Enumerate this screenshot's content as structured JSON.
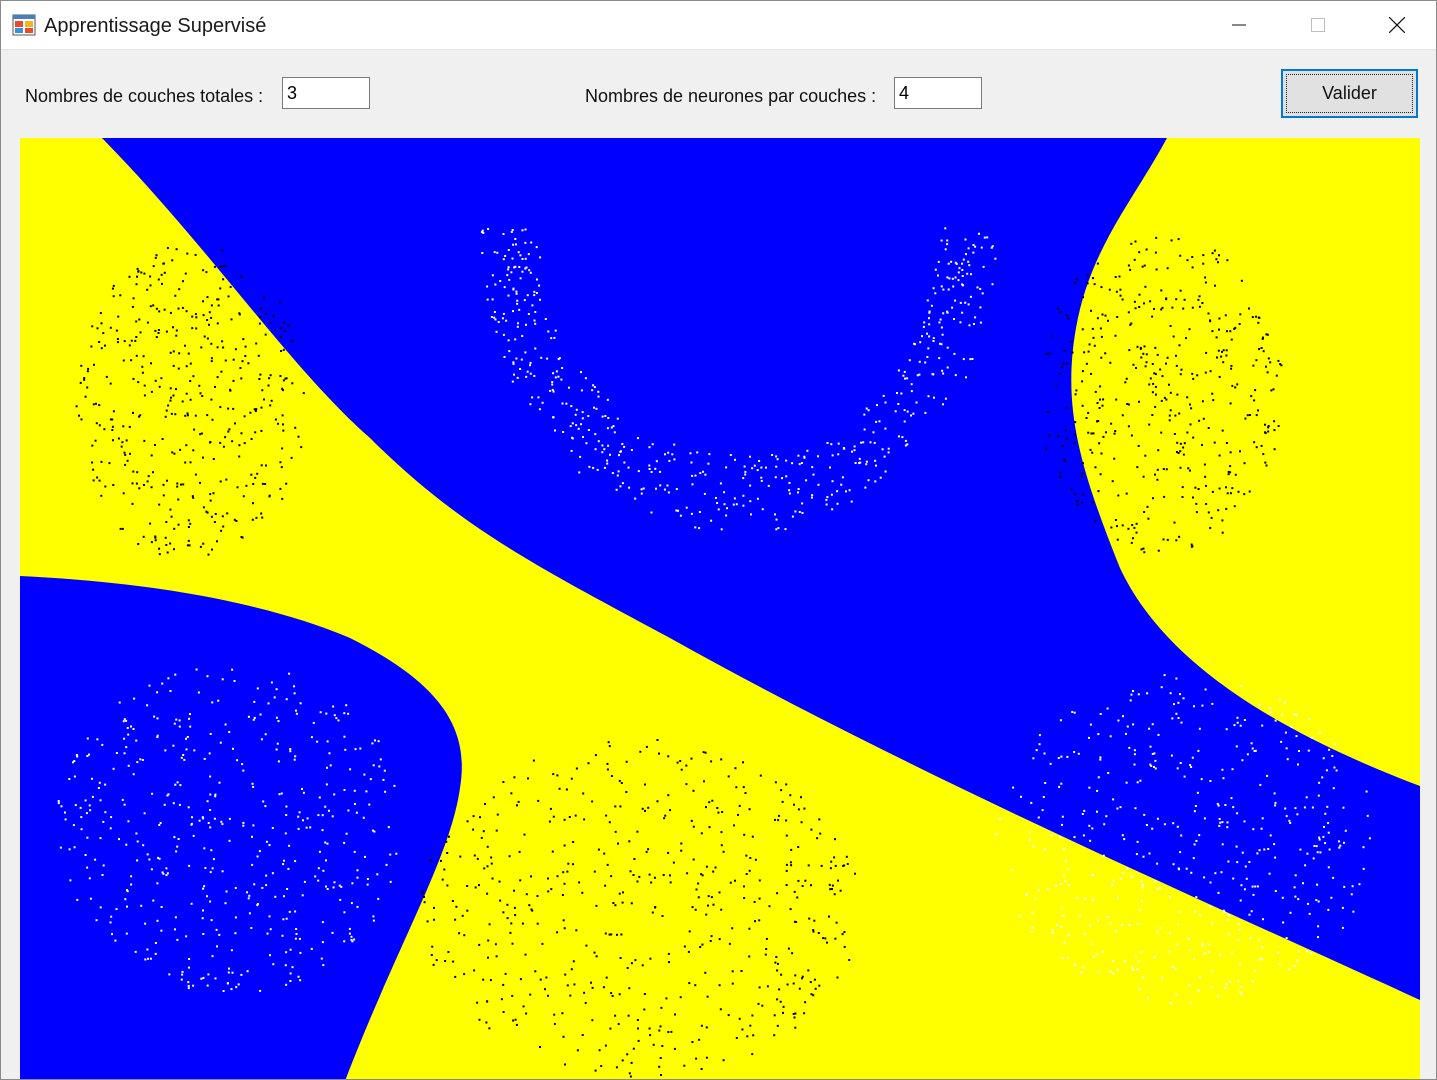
{
  "window": {
    "title": "Apprentissage Supervisé",
    "icon": "windows-forms-app-icon",
    "controls": [
      "minimize-icon",
      "maximize-icon",
      "close-icon"
    ]
  },
  "form": {
    "layers_label": "Nombres de couches totales :",
    "layers_value": "3",
    "neurons_label": "Nombres de neurones par couches :",
    "neurons_value": "4",
    "submit_label": "Valider"
  },
  "plot": {
    "class_a_color": "#0000ff",
    "class_b_color": "#ffff00",
    "point_a_color": "#ffffff",
    "point_b_color": "#000000"
  }
}
